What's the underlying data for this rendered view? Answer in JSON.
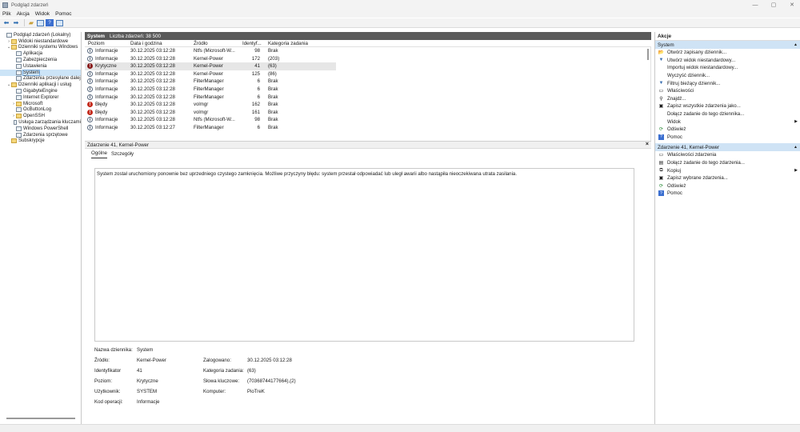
{
  "window": {
    "title": "Podgląd zdarzeń",
    "minimize": "—",
    "maximize": "▢",
    "close": "✕"
  },
  "menu": [
    "Plik",
    "Akcja",
    "Widok",
    "Pomoc"
  ],
  "tree": [
    {
      "label": "Podgląd zdarzeń (Lokalny)",
      "indent": 0,
      "caret": "",
      "icon": "event-viewer-icon",
      "selected": false
    },
    {
      "label": "Widoki niestandardowe",
      "indent": 1,
      "caret": "›",
      "icon": "folder-icon",
      "selected": false
    },
    {
      "label": "Dzienniki systemu Windows",
      "indent": 1,
      "caret": "⌄",
      "icon": "folder-icon",
      "selected": false
    },
    {
      "label": "Aplikacja",
      "indent": 2,
      "caret": "",
      "icon": "log-icon",
      "selected": false
    },
    {
      "label": "Zabezpieczenia",
      "indent": 2,
      "caret": "",
      "icon": "log-icon",
      "selected": false
    },
    {
      "label": "Ustawienia",
      "indent": 2,
      "caret": "",
      "icon": "log-icon",
      "selected": false
    },
    {
      "label": "System",
      "indent": 2,
      "caret": "",
      "icon": "log-icon",
      "selected": true
    },
    {
      "label": "Zdarzenia przesyłane dalej",
      "indent": 2,
      "caret": "",
      "icon": "log-icon",
      "selected": false
    },
    {
      "label": "Dzienniki aplikacji i usług",
      "indent": 1,
      "caret": "⌄",
      "icon": "folder-icon",
      "selected": false
    },
    {
      "label": "GigabyteEngine",
      "indent": 2,
      "caret": "",
      "icon": "log-icon",
      "selected": false
    },
    {
      "label": "Internet Explorer",
      "indent": 2,
      "caret": "",
      "icon": "log-icon",
      "selected": false
    },
    {
      "label": "Microsoft",
      "indent": 2,
      "caret": "›",
      "icon": "folder-icon",
      "selected": false
    },
    {
      "label": "OcButtonLog",
      "indent": 2,
      "caret": "",
      "icon": "log-icon",
      "selected": false
    },
    {
      "label": "OpenSSH",
      "indent": 2,
      "caret": "›",
      "icon": "folder-icon",
      "selected": false
    },
    {
      "label": "Usługa zarządzania kluczami",
      "indent": 2,
      "caret": "",
      "icon": "log-icon",
      "selected": false
    },
    {
      "label": "Windows PowerShell",
      "indent": 2,
      "caret": "",
      "icon": "log-icon",
      "selected": false
    },
    {
      "label": "Zdarzenia sprzętowe",
      "indent": 2,
      "caret": "",
      "icon": "log-icon",
      "selected": false
    },
    {
      "label": "Subskrypcje",
      "indent": 1,
      "caret": "",
      "icon": "subscription-icon",
      "selected": false
    }
  ],
  "center": {
    "log_name": "System",
    "event_count": "Liczba zdarzeń: 38 500",
    "columns": [
      "Poziom",
      "Data i godzina",
      "Źródło",
      "Identyf...",
      "Kategoria zadania"
    ],
    "rows": [
      {
        "level": "Informacje",
        "icon": "info",
        "date": "30.12.2025 03:12:28",
        "source": "Ntfs (Microsoft-W...",
        "id": "98",
        "category": "Brak",
        "selected": false
      },
      {
        "level": "Informacje",
        "icon": "info",
        "date": "30.12.2025 03:12:28",
        "source": "Kernel-Power",
        "id": "172",
        "category": "(203)",
        "selected": false
      },
      {
        "level": "Krytyczne",
        "icon": "crit",
        "date": "30.12.2025 03:12:28",
        "source": "Kernel-Power",
        "id": "41",
        "category": "(63)",
        "selected": true
      },
      {
        "level": "Informacje",
        "icon": "info",
        "date": "30.12.2025 03:12:28",
        "source": "Kernel-Power",
        "id": "125",
        "category": "(86)",
        "selected": false
      },
      {
        "level": "Informacje",
        "icon": "info",
        "date": "30.12.2025 03:12:28",
        "source": "FilterManager",
        "id": "6",
        "category": "Brak",
        "selected": false
      },
      {
        "level": "Informacje",
        "icon": "info",
        "date": "30.12.2025 03:12:28",
        "source": "FilterManager",
        "id": "6",
        "category": "Brak",
        "selected": false
      },
      {
        "level": "Informacje",
        "icon": "info",
        "date": "30.12.2025 03:12:28",
        "source": "FilterManager",
        "id": "6",
        "category": "Brak",
        "selected": false
      },
      {
        "level": "Błędy",
        "icon": "err",
        "date": "30.12.2025 03:12:28",
        "source": "volmgr",
        "id": "162",
        "category": "Brak",
        "selected": false
      },
      {
        "level": "Błędy",
        "icon": "err",
        "date": "30.12.2025 03:12:28",
        "source": "volmgr",
        "id": "161",
        "category": "Brak",
        "selected": false
      },
      {
        "level": "Informacje",
        "icon": "info",
        "date": "30.12.2025 03:12:28",
        "source": "Ntfs (Microsoft-W...",
        "id": "98",
        "category": "Brak",
        "selected": false
      },
      {
        "level": "Informacje",
        "icon": "info",
        "date": "30.12.2025 03:12:27",
        "source": "FilterManager",
        "id": "6",
        "category": "Brak",
        "selected": false
      }
    ],
    "detail_title": "Zdarzenie 41, Kernel-Power",
    "detail_close": "×",
    "tabs": [
      "Ogólne",
      "Szczegóły"
    ],
    "description": "System został uruchomiony ponownie bez uprzedniego czystego zamknięcia. Możliwe przyczyny błędu: system przestał odpowiadać lub uległ awarii albo nastąpiła nieoczekiwana utrata zasilania.",
    "props": {
      "log_name_label": "Nazwa dziennika:",
      "log_name_value": "System",
      "source_label": "Źródło:",
      "source_value": "Kernel-Power",
      "logged_label": "Zalogowano:",
      "logged_value": "30.12.2025 03:12:28",
      "id_label": "Identyfikator",
      "id_value": "41",
      "task_label": "Kategoria zadania:",
      "task_value": "(63)",
      "level_label": "Poziom:",
      "level_value": "Krytyczne",
      "keywords_label": "Słowa kluczowe:",
      "keywords_value": "(70368744177664),(2)",
      "user_label": "Użytkownik:",
      "user_value": "SYSTEM",
      "computer_label": "Komputer:",
      "computer_value": "PioTreK",
      "opcode_label": "Kod operacji:",
      "opcode_value": "Informacje"
    }
  },
  "actions": {
    "title": "Akcje",
    "section1": "System",
    "items1": [
      {
        "label": "Otwórz zapisany dziennik...",
        "icon": "open-icon",
        "glyph": "📂",
        "submenu": false
      },
      {
        "label": "Utwórz widok niestandardowy...",
        "icon": "filter-icon",
        "glyph": "▼",
        "submenu": false
      },
      {
        "label": "Importuj widok niestandardowy...",
        "icon": "",
        "glyph": "",
        "submenu": false
      },
      {
        "label": "Wyczyść dziennik...",
        "icon": "",
        "glyph": "",
        "submenu": false
      },
      {
        "label": "Filtruj bieżący dziennik...",
        "icon": "filter-icon",
        "glyph": "▼",
        "submenu": false
      },
      {
        "label": "Właściwości",
        "icon": "properties-icon",
        "glyph": "▭",
        "submenu": false
      },
      {
        "label": "Znajdź...",
        "icon": "find-icon",
        "glyph": "⚲",
        "submenu": false
      },
      {
        "label": "Zapisz wszystkie zdarzenia jako...",
        "icon": "save-icon",
        "glyph": "▣",
        "submenu": false
      },
      {
        "label": "Dołącz zadanie do tego dziennika...",
        "icon": "",
        "glyph": "",
        "submenu": false
      },
      {
        "label": "Widok",
        "icon": "",
        "glyph": "",
        "submenu": true
      },
      {
        "label": "Odśwież",
        "icon": "refresh-icon",
        "glyph": "⟳",
        "submenu": false
      },
      {
        "label": "Pomoc",
        "icon": "help-icon",
        "glyph": "?",
        "submenu": false
      }
    ],
    "section2": "Zdarzenie 41, Kernel-Power",
    "items2": [
      {
        "label": "Właściwości zdarzenia",
        "icon": "properties-icon",
        "glyph": "▭",
        "submenu": false
      },
      {
        "label": "Dołącz zadanie do tego zdarzenia...",
        "icon": "task-icon",
        "glyph": "▤",
        "submenu": false
      },
      {
        "label": "Kopiuj",
        "icon": "copy-icon",
        "glyph": "⧉",
        "submenu": true
      },
      {
        "label": "Zapisz wybrane zdarzenia...",
        "icon": "save-icon",
        "glyph": "▣",
        "submenu": false
      },
      {
        "label": "Odśwież",
        "icon": "refresh-icon",
        "glyph": "⟳",
        "submenu": false
      },
      {
        "label": "Pomoc",
        "icon": "help-icon",
        "glyph": "?",
        "submenu": false
      }
    ]
  },
  "colors": {
    "header_bg": "#5a5a5a",
    "section_bg": "#cfe3f5",
    "selected_tree": "#cce4f7",
    "critical": "#8a1d1d",
    "error": "#c42b1c"
  }
}
